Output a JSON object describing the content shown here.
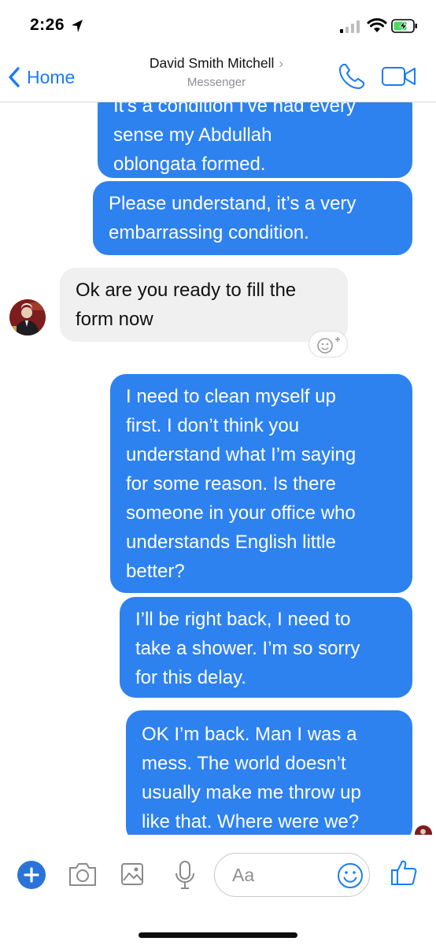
{
  "status_bar": {
    "time": "2:26"
  },
  "header": {
    "back_label": "Home",
    "contact_name": "David Smith Mitchell",
    "contact_subtitle": "Messenger",
    "accent_color": "#1a7cf5"
  },
  "messages": [
    {
      "direction": "outgoing",
      "lines": [
        "It's a condition I've had every",
        "sense my Abdullah",
        "oblongata formed."
      ]
    },
    {
      "direction": "outgoing",
      "lines": [
        "Please understand, it’s a very",
        "embarrassing condition."
      ]
    },
    {
      "direction": "incoming",
      "lines": [
        "Ok are you ready to fill the",
        "form now"
      ]
    },
    {
      "direction": "outgoing",
      "lines": [
        "I need to clean myself up",
        "first. I don’t think you",
        "understand what I’m saying",
        "for some reason. Is there",
        "someone in your office who",
        "understands English little",
        "better?"
      ]
    },
    {
      "direction": "outgoing",
      "lines": [
        "I’ll be right back, I need to",
        "take a shower. I’m so sorry",
        "for this delay."
      ]
    },
    {
      "direction": "outgoing",
      "lines": [
        "OK I’m back. Man I was a",
        "mess. The world doesn’t",
        "usually make me throw up",
        "like that. Where were we?"
      ]
    }
  ],
  "composer": {
    "placeholder": "Aa"
  },
  "colors": {
    "outgoing_bubble": "#2d82f0",
    "incoming_bubble": "#f1f0f0",
    "plus_button": "#2a73d8"
  },
  "icons": [
    "location-arrow-icon",
    "signal-icon",
    "wifi-icon",
    "battery-charging-icon",
    "chevron-left-icon",
    "chevron-right-icon",
    "phone-icon",
    "video-camera-icon",
    "add-reaction-icon",
    "plus-icon",
    "camera-icon",
    "image-icon",
    "microphone-icon",
    "emoji-icon",
    "thumbs-up-icon"
  ]
}
